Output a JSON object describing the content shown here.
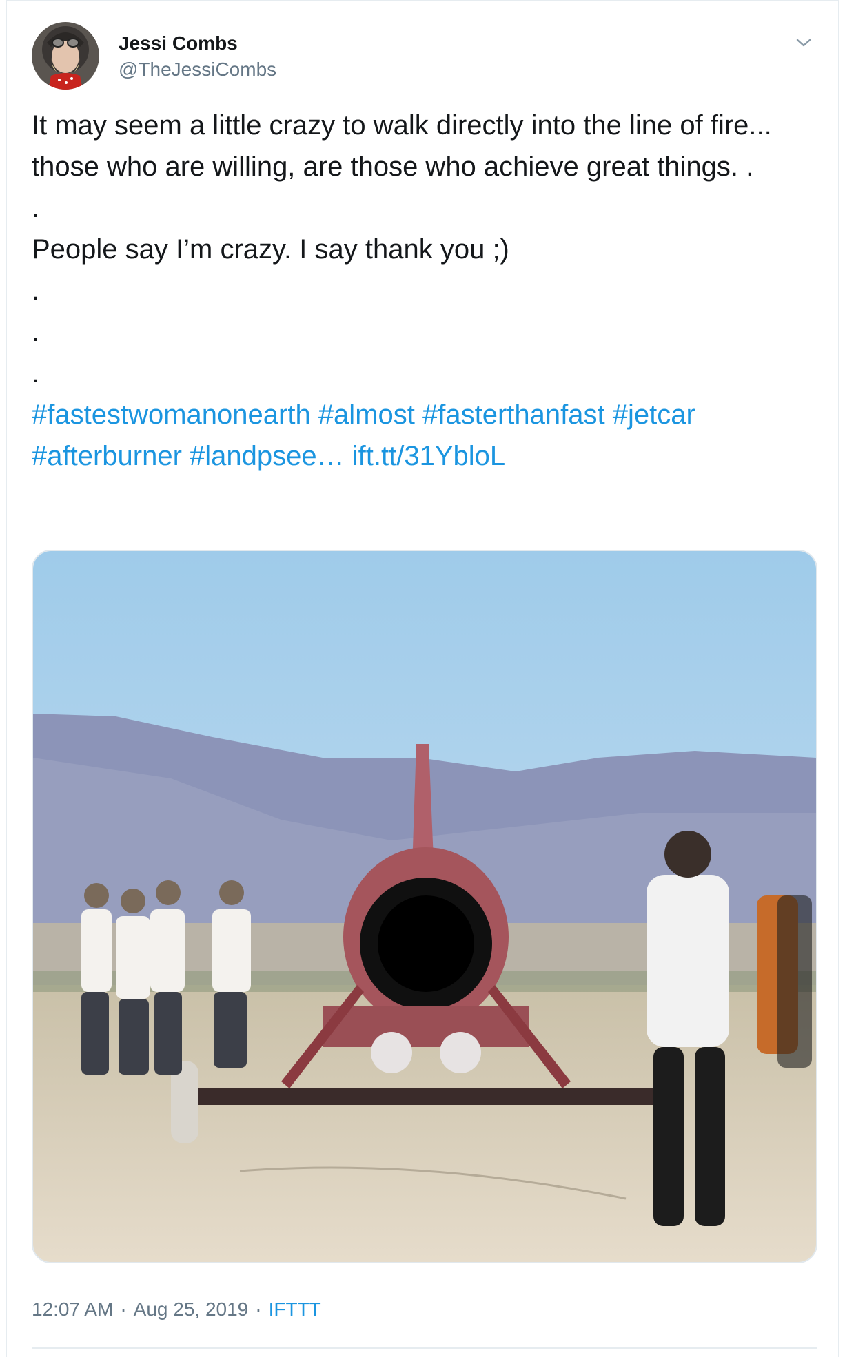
{
  "user": {
    "display_name": "Jessi Combs",
    "handle": "@TheJessiCombs",
    "avatar_icon": "profile-photo"
  },
  "menu": {
    "icon": "chevron-down-icon"
  },
  "tweet": {
    "line1": "It may seem a little crazy to walk directly into the line of fire... those who are willing, are those who achieve great things. .",
    "dot1": ".",
    "line2": "People say I’m crazy. I say thank you ;)",
    "dot2": ".",
    "dot3": ".",
    "dot4": ".",
    "hashtags": [
      "#fastestwomanonearth",
      "#almost",
      "#fasterthanfast",
      "#jetcar",
      "#afterburner",
      "#landpsee…"
    ],
    "link": "ift.tt/31YbloL"
  },
  "media": {
    "icon": "jet-car-photo"
  },
  "footer": {
    "time": "12:07 AM",
    "separator1": "·",
    "date": "Aug 25, 2019",
    "separator2": "·",
    "source": "IFTTT"
  },
  "colors": {
    "link": "#1b95e0",
    "text": "#14171a",
    "secondary": "#657786",
    "border": "#e6ecf0"
  }
}
